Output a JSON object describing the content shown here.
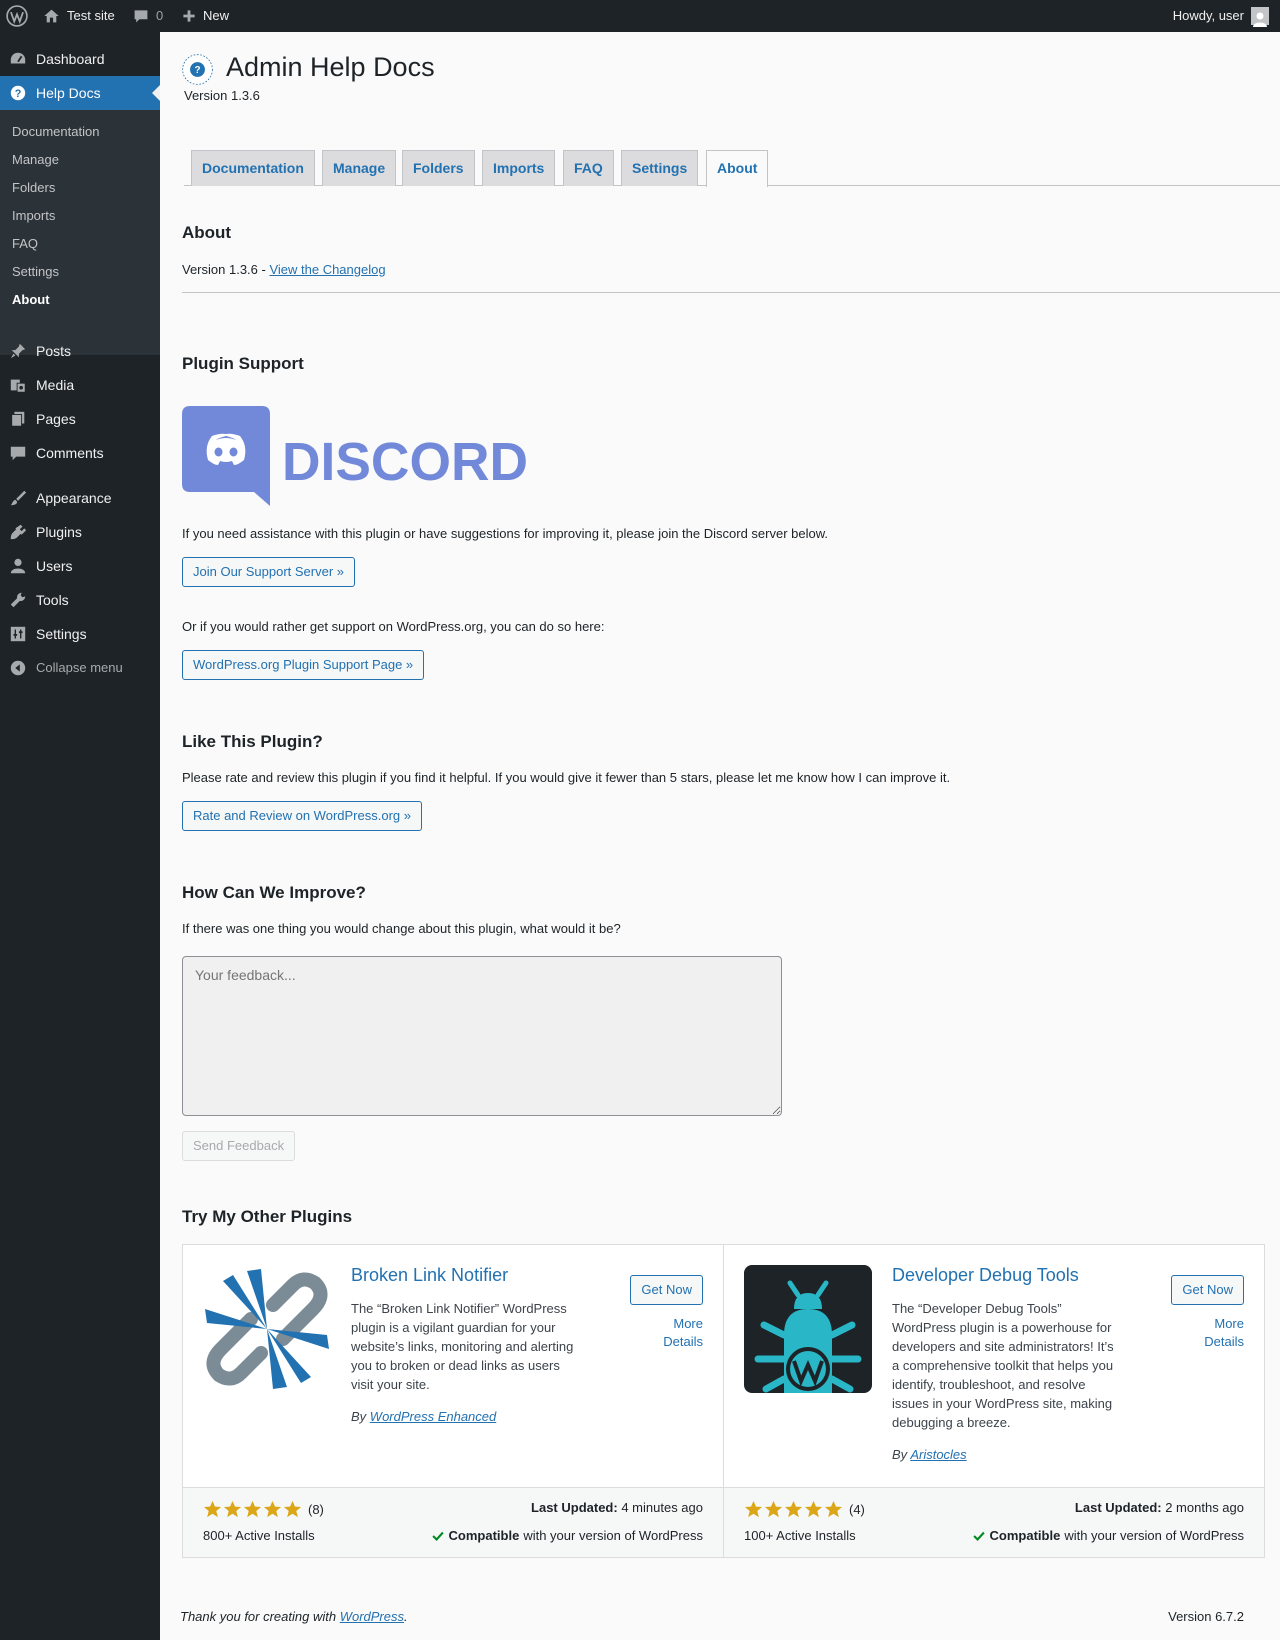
{
  "adminbar": {
    "site_name": "Test site",
    "comments_count": "0",
    "new_label": "New",
    "howdy": "Howdy, user"
  },
  "sidebar": {
    "dashboard": "Dashboard",
    "help_docs": "Help Docs",
    "submenu": [
      "Documentation",
      "Manage",
      "Folders",
      "Imports",
      "FAQ",
      "Settings",
      "About"
    ],
    "posts": "Posts",
    "media": "Media",
    "pages": "Pages",
    "comments": "Comments",
    "appearance": "Appearance",
    "plugins": "Plugins",
    "users": "Users",
    "tools": "Tools",
    "settings": "Settings",
    "collapse": "Collapse menu"
  },
  "header": {
    "title": "Admin Help Docs",
    "version": "Version 1.3.6",
    "logo_text": "ADMIN HELP DOCS"
  },
  "tabs": [
    "Documentation",
    "Manage",
    "Folders",
    "Imports",
    "FAQ",
    "Settings",
    "About"
  ],
  "active_tab": "About",
  "about": {
    "heading": "About",
    "version_prefix": "Version 1.3.6 - ",
    "changelog_link": "View the Changelog"
  },
  "support": {
    "heading": "Plugin Support",
    "discord_wordmark": "DISCORD",
    "intro": "If you need assistance with this plugin or have suggestions for improving it, please join the Discord server below.",
    "join_button": "Join Our Support Server »",
    "alt_text": "Or if you would rather get support on WordPress.org, you can do so here:",
    "wporg_button": "WordPress.org Plugin Support Page »"
  },
  "like": {
    "heading": "Like This Plugin?",
    "text": "Please rate and review this plugin if you find it helpful. If you would give it fewer than 5 stars, please let me know how I can improve it.",
    "button": "Rate and Review on WordPress.org »"
  },
  "improve": {
    "heading": "How Can We Improve?",
    "question": "If there was one thing you would change about this plugin, what would it be?",
    "placeholder": "Your feedback...",
    "send_button": "Send Feedback"
  },
  "other_plugins": {
    "heading": "Try My Other Plugins",
    "items": [
      {
        "name": "Broken Link Notifier",
        "description": "The “Broken Link Notifier” WordPress plugin is a vigilant guardian for your website’s links, monitoring and alerting you to broken or dead links as users visit your site.",
        "by_prefix": "By ",
        "author": "WordPress Enhanced",
        "get_now": "Get Now",
        "more_details_1": "More",
        "more_details_2": "Details",
        "rating_stars": 5,
        "rating_count": "(8)",
        "installs": "800+ Active Installs",
        "last_updated_label": "Last Updated:",
        "last_updated_value": "4 minutes ago",
        "compatible_label": "Compatible",
        "compatible_text": "with your version of WordPress"
      },
      {
        "name": "Developer Debug Tools",
        "description": "The “Developer Debug Tools” WordPress plugin is a powerhouse for developers and site administrators! It’s a comprehensive toolkit that helps you identify, troubleshoot, and resolve issues in your WordPress site, making debugging a breeze.",
        "by_prefix": "By ",
        "author": "Aristocles",
        "get_now": "Get Now",
        "more_details_1": "More",
        "more_details_2": "Details",
        "rating_stars": 5,
        "rating_count": "(4)",
        "installs": "100+ Active Installs",
        "last_updated_label": "Last Updated:",
        "last_updated_value": "2 months ago",
        "compatible_label": "Compatible",
        "compatible_text": "with your version of WordPress"
      }
    ]
  },
  "footer": {
    "thanks_prefix": "Thank you for creating with ",
    "wordpress_link": "WordPress",
    "thanks_suffix": ".",
    "version": "Version 6.7.2"
  },
  "colors": {
    "admin_dark": "#1d2327",
    "accent_blue": "#2271b1",
    "discord_blurple": "#7289da",
    "star_gold": "#dba617",
    "compat_green": "#008a20"
  }
}
